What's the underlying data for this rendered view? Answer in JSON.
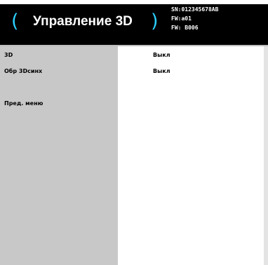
{
  "header": {
    "title": "Управление 3D",
    "bracket_left": "(",
    "bracket_right": ")",
    "serial": "SN:012345678AB",
    "fw1": "FW:a01",
    "fw2": "FW: B006"
  },
  "menu": {
    "items": [
      {
        "label": "3D",
        "value": "Выкл"
      },
      {
        "label": "Обр 3Dсинх",
        "value": "Выкл"
      }
    ],
    "back_label": "Пред. меню"
  },
  "colors": {
    "header_bg": "#000000",
    "accent": "#2bd0ff",
    "sidebar_bg": "#c8c8c8",
    "content_bg": "#ffffff"
  }
}
